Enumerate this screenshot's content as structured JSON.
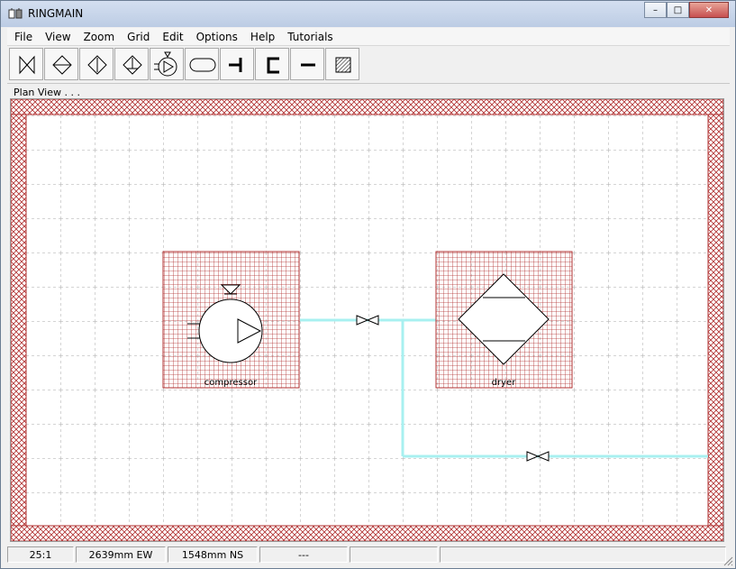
{
  "window": {
    "title": "RINGMAIN"
  },
  "window_buttons": {
    "minimize": "–",
    "maximize": "□",
    "close": "✕"
  },
  "menu": [
    "File",
    "View",
    "Zoom",
    "Grid",
    "Edit",
    "Options",
    "Help",
    "Tutorials"
  ],
  "toolbar": {
    "tools": [
      "valve-tool",
      "check-valve-tool",
      "regulator-tool",
      "filter-tool",
      "compressor-tool",
      "receiver-tool",
      "tee-tool",
      "bend-tool",
      "pipe-tool",
      "wall-tool"
    ]
  },
  "view": {
    "label": "Plan View . . ."
  },
  "canvas": {
    "components": [
      {
        "type": "compressor",
        "label": "compressor"
      },
      {
        "type": "dryer",
        "label": "dryer"
      }
    ],
    "colors": {
      "hatch": "#b03030",
      "pipe": "#a8f0f0",
      "grid": "#a8a8a8"
    }
  },
  "status": {
    "scale": "25:1",
    "ew": "2639mm EW",
    "ns": "1548mm NS",
    "mode": "---",
    "extra": ""
  }
}
